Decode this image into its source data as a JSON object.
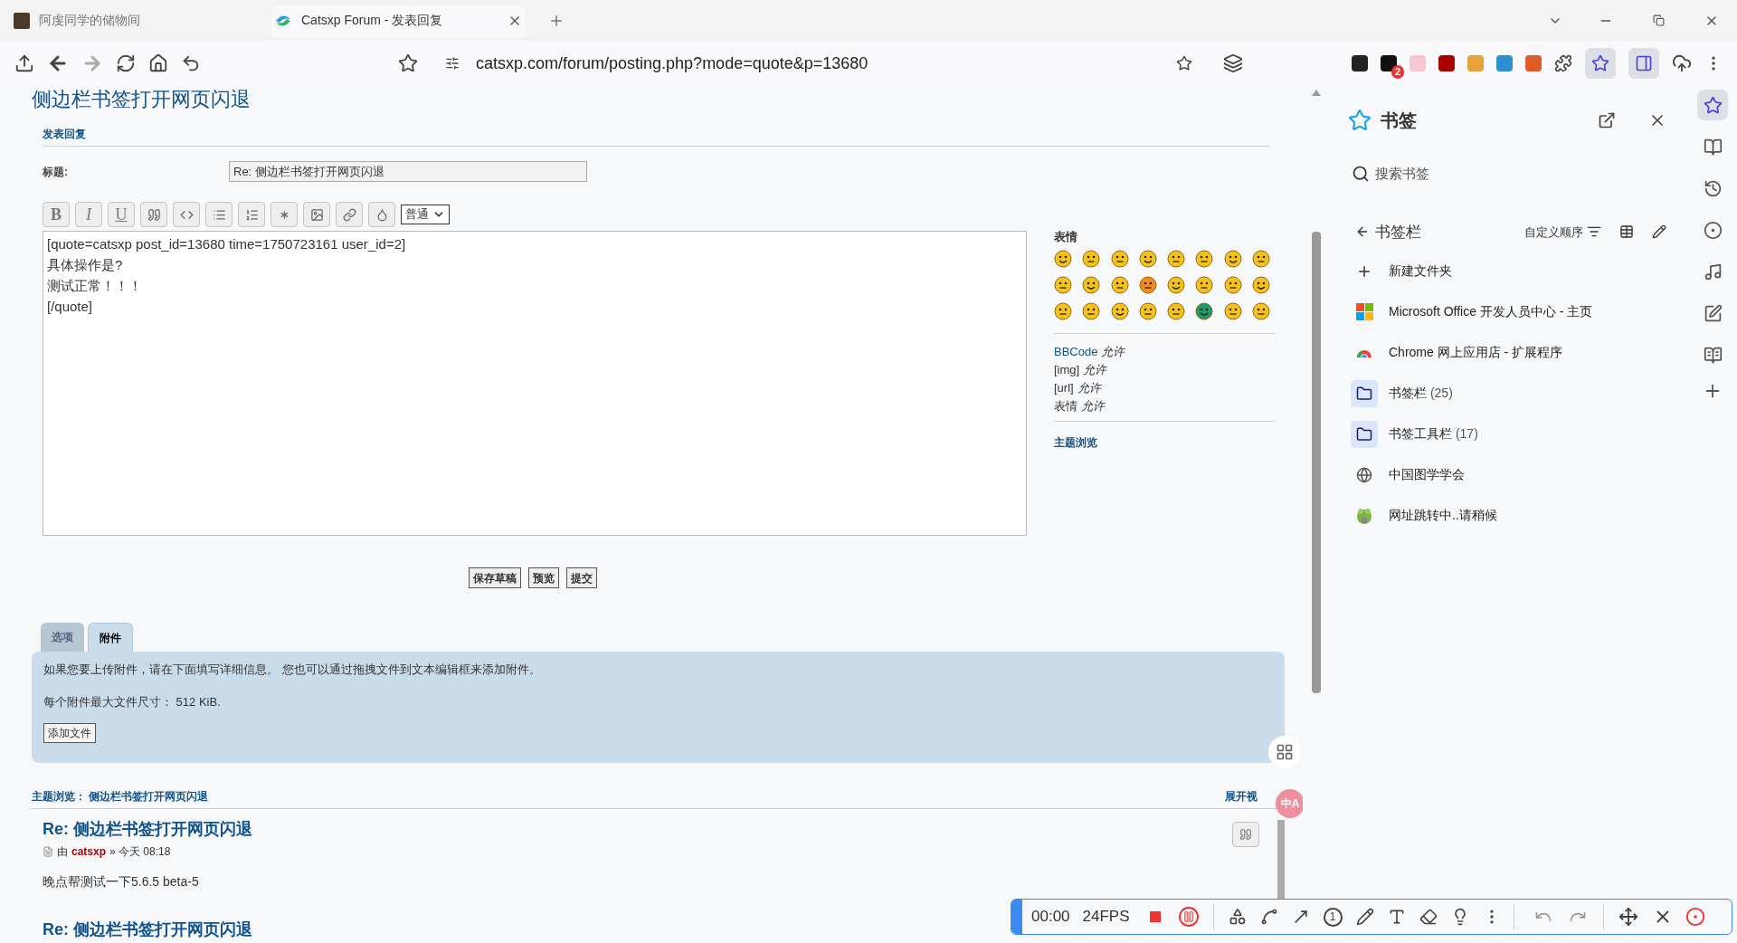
{
  "browser": {
    "tabs": [
      {
        "title": "阿虔同学的储物间",
        "selected": false
      },
      {
        "title": "Catsxp Forum - 发表回复",
        "selected": true
      }
    ],
    "address": "catsxp.com/forum/posting.php?mode=quote&p=13680",
    "extension_badge": "2"
  },
  "page": {
    "title": "侧边栏书签打开网页闪退",
    "section": "发表回复",
    "subject_label": "标题:",
    "subject_value": "Re: 侧边栏书签打开网页闪退",
    "format_buttons": [
      "B",
      "I",
      "U"
    ],
    "font_size": "普通",
    "message_lines": [
      "[quote=catsxp post_id=13680 time=1750723161 user_id=2]",
      "具体操作是?",
      "测试正常！！！",
      "[/quote]"
    ],
    "smilies_title": "表情",
    "permissions": [
      {
        "name": "BBCode",
        "value": "允许",
        "link": true
      },
      {
        "name": "[img]",
        "value": "允许",
        "link": false
      },
      {
        "name": "[url]",
        "value": "允许",
        "link": false
      },
      {
        "name": "表情",
        "value": "允许",
        "link": false
      }
    ],
    "topic_review_link": "主题浏览",
    "actions": [
      "保存草稿",
      "预览",
      "提交"
    ],
    "panel_tabs": [
      {
        "label": "选项",
        "selected": false
      },
      {
        "label": "附件",
        "selected": true
      }
    ],
    "attachment": {
      "text": "如果您要上传附件，请在下面填写详细信息。 您也可以通过拖拽文件到文本编辑框来添加附件。",
      "max_size": "每个附件最大文件尺寸： 512 KiB.",
      "button": "添加文件"
    },
    "review": {
      "title": "主题浏览：  侧边栏书签打开网页闪退",
      "expand": "展开视",
      "posts": [
        {
          "title": "Re: 侧边栏书签打开网页闪退",
          "by": "由",
          "author": "catsxp",
          "time": "» 今天 08:18",
          "body": "晚点帮测试一下5.6.5 beta-5"
        },
        {
          "title": "Re: 侧边栏书签打开网页闪退"
        }
      ]
    },
    "floating_badge": "中A"
  },
  "sidebar": {
    "title": "书签",
    "search_placeholder": "搜索书签",
    "folder": "书签栏",
    "sort": "自定义顺序",
    "items": [
      {
        "kind": "new",
        "label": "新建文件夹"
      },
      {
        "kind": "microsoft",
        "label": "Microsoft Office 开发人员中心 - 主页"
      },
      {
        "kind": "chrome",
        "label": "Chrome 网上应用店 - 扩展程序"
      },
      {
        "kind": "folder",
        "label": "书签栏",
        "count": "(25)"
      },
      {
        "kind": "folder",
        "label": "书签工具栏",
        "count": "(17)"
      },
      {
        "kind": "globe",
        "label": "中国图学学会"
      },
      {
        "kind": "frog",
        "label": "网址跳转中..请稍候"
      }
    ]
  },
  "rail": [
    {
      "selected": true
    },
    {
      "selected": false
    },
    {
      "selected": false
    },
    {
      "selected": false
    },
    {
      "selected": false
    },
    {
      "selected": false
    },
    {
      "selected": false
    }
  ],
  "recorder": {
    "time": "00:00",
    "fps": "24FPS",
    "step_number": "1"
  }
}
